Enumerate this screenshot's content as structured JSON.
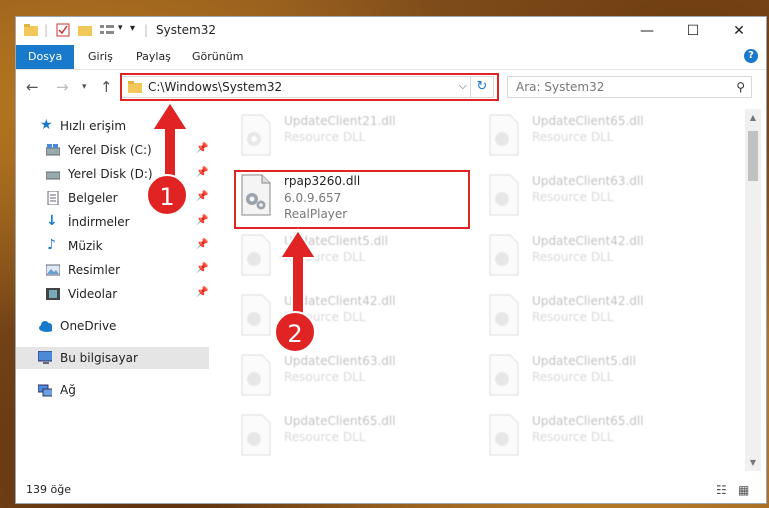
{
  "window": {
    "title": "System32",
    "minimize_glyph": "—",
    "maximize_glyph": "☐",
    "close_glyph": "✕"
  },
  "ribbon": {
    "tabs": [
      {
        "label": "Dosya",
        "active": true
      },
      {
        "label": "Giriş",
        "active": false
      },
      {
        "label": "Paylaş",
        "active": false
      },
      {
        "label": "Görünüm",
        "active": false
      }
    ],
    "help": "?"
  },
  "navigation": {
    "address": "C:\\Windows\\System32",
    "search_placeholder": "Ara: System32"
  },
  "sidebar": {
    "quick_access": "Hızlı erişim",
    "items": [
      {
        "label": "Yerel Disk (C:)",
        "icon": "drive-icon",
        "pinned": true
      },
      {
        "label": "Yerel Disk (D:)",
        "icon": "drive-icon",
        "pinned": true
      },
      {
        "label": "Belgeler",
        "icon": "documents-icon",
        "pinned": true
      },
      {
        "label": "İndirmeler",
        "icon": "download-icon",
        "pinned": true
      },
      {
        "label": "Müzik",
        "icon": "music-icon",
        "pinned": true
      },
      {
        "label": "Resimler",
        "icon": "pictures-icon",
        "pinned": true
      },
      {
        "label": "Videolar",
        "icon": "videos-icon",
        "pinned": true
      }
    ],
    "onedrive": "OneDrive",
    "this_pc": "Bu bilgisayar",
    "network": "Ağ"
  },
  "files": {
    "highlighted": {
      "name": "rpap3260.dll",
      "version": "6.0.9.657",
      "company": "RealPlayer"
    },
    "left_column": [
      {
        "name": "UpdateClient21.dll",
        "desc": "Resource DLL"
      },
      {
        "name": "UpdateClient5.dll",
        "desc": "Resource DLL"
      },
      {
        "name": "UpdateClient42.dll",
        "desc": "Resource DLL"
      },
      {
        "name": "UpdateClient63.dll",
        "desc": "Resource DLL"
      },
      {
        "name": "UpdateClient65.dll",
        "desc": "Resource DLL"
      }
    ],
    "right_column": [
      {
        "name": "UpdateClient65.dll",
        "desc": "Resource DLL"
      },
      {
        "name": "UpdateClient63.dll",
        "desc": "Resource DLL"
      },
      {
        "name": "UpdateClient42.dll",
        "desc": "Resource DLL"
      },
      {
        "name": "UpdateClient42.dll",
        "desc": "Resource DLL"
      },
      {
        "name": "UpdateClient5.dll",
        "desc": "Resource DLL"
      },
      {
        "name": "UpdateClient65.dll",
        "desc": "Resource DLL"
      }
    ]
  },
  "status": {
    "item_count": "139 öğe"
  },
  "annotations": {
    "step1": "1",
    "step2": "2",
    "color": "#e02424"
  }
}
